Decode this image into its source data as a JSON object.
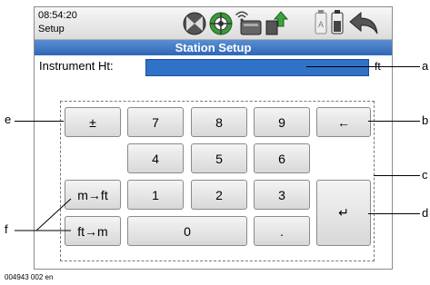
{
  "status": {
    "time": "08:54:20",
    "mode": "Setup",
    "icons": [
      "prism-target-icon",
      "gps-target-icon",
      "radio-signal-icon",
      "memory-card-icon",
      "data-transfer-icon",
      "battery-icon",
      "back-arrow-icon"
    ]
  },
  "title": "Station Setup",
  "field": {
    "label": "Instrument Ht:",
    "unit": "ft"
  },
  "keys": {
    "plus_minus": "±",
    "seven": "7",
    "eight": "8",
    "nine": "9",
    "backspace": "←",
    "four": "4",
    "five": "5",
    "six": "6",
    "m_to_ft": "m→ft",
    "one": "1",
    "two": "2",
    "three": "3",
    "enter": "↵",
    "ft_to_m": "ft→m",
    "zero": "0",
    "decimal": "."
  },
  "callouts": {
    "a": "a",
    "b": "b",
    "c": "c",
    "d": "d",
    "e": "e",
    "f": "f"
  },
  "footer": "004943 002 en",
  "colors": {
    "title_bar": "#3a73c0",
    "field_fill": "#2f72c7"
  }
}
